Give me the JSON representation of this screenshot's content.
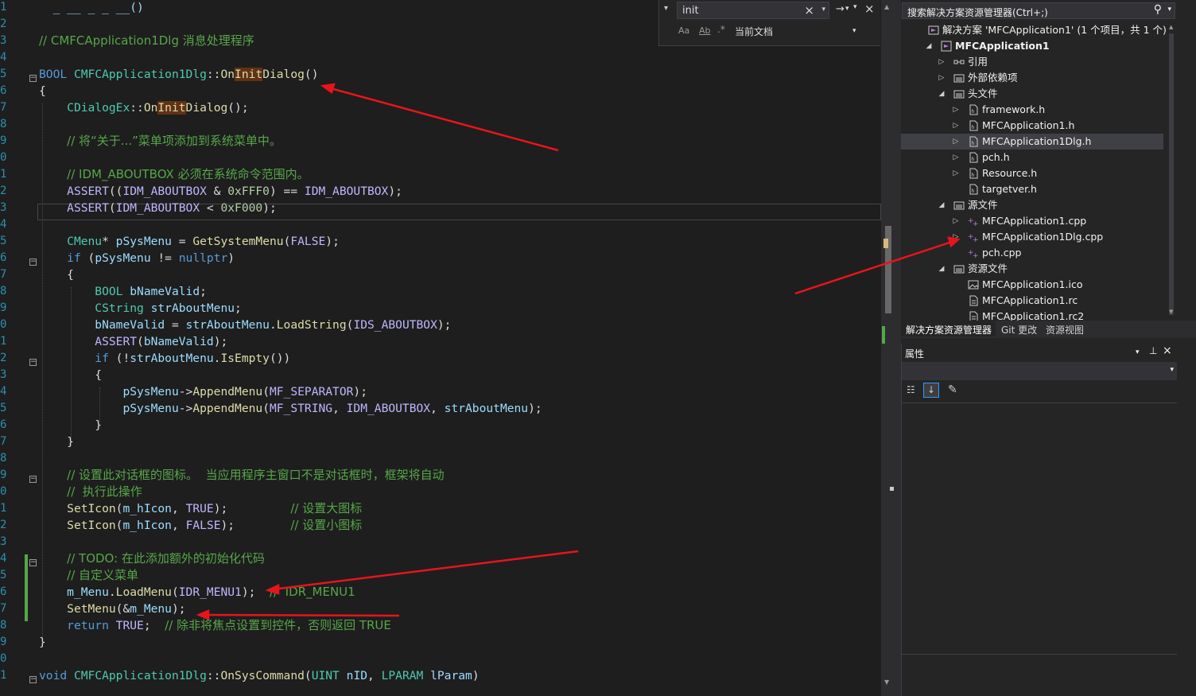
{
  "editor": {
    "lines": [
      {
        "num": "1",
        "html": "<span class='v'>  _ __ _ _ __()</span>"
      },
      {
        "num": "2",
        "html": ""
      },
      {
        "num": "3",
        "html": "<span class='c'>// CMFCApplication1Dlg 消息处理程序</span>"
      },
      {
        "num": "4",
        "html": ""
      },
      {
        "num": "5",
        "html": "<span class='k'>BOOL</span> <span class='t'>CMFCApplication1Dlg</span>::<span class='f'>On<span class='hl'>Init</span>Dialog</span>()"
      },
      {
        "num": "6",
        "html": "{"
      },
      {
        "num": "7",
        "html": "    <span class='t'>CDialogEx</span>::<span class='f'>On<span class='hl'>Init</span>Dialog</span>();"
      },
      {
        "num": "8",
        "html": ""
      },
      {
        "num": "9",
        "html": "    <span class='c'>// 将“关于...”菜单项添加到系统菜单中。</span>"
      },
      {
        "num": "0",
        "html": ""
      },
      {
        "num": "1",
        "html": "    <span class='c'>// IDM_ABOUTBOX 必须在系统命令范围内。</span>"
      },
      {
        "num": "2",
        "html": "    <span class='mac'>ASSERT</span>((<span class='mac'>IDM_ABOUTBOX</span> &amp; <span class='n'>0xFFF0</span>) == <span class='mac'>IDM_ABOUTBOX</span>);"
      },
      {
        "num": "3",
        "html": "    <span class='mac'>ASSERT</span>(<span class='mac'>IDM_ABOUTBOX</span> &lt; <span class='n'>0xF000</span>);"
      },
      {
        "num": "4",
        "html": ""
      },
      {
        "num": "5",
        "html": "    <span class='t'>CMenu</span>* <span class='v'>pSysMenu</span> = <span class='f'>GetSystemMenu</span>(<span class='mac'>FALSE</span>);"
      },
      {
        "num": "6",
        "html": "    <span class='k'>if</span> (<span class='v'>pSysMenu</span> != <span class='k'>nullptr</span>)"
      },
      {
        "num": "7",
        "html": "    {"
      },
      {
        "num": "8",
        "html": "        <span class='t'>BOOL</span> <span class='v'>bNameValid</span>;"
      },
      {
        "num": "9",
        "html": "        <span class='t'>CString</span> <span class='v'>strAboutMenu</span>;"
      },
      {
        "num": "0",
        "html": "        <span class='v'>bNameValid</span> = <span class='v'>strAboutMenu</span>.<span class='f'>LoadString</span>(<span class='mac'>IDS_ABOUTBOX</span>);"
      },
      {
        "num": "1",
        "html": "        <span class='mac'>ASSERT</span>(<span class='v'>bNameValid</span>);"
      },
      {
        "num": "2",
        "html": "        <span class='k'>if</span> (!<span class='v'>strAboutMenu</span>.<span class='f'>IsEmpty</span>())"
      },
      {
        "num": "3",
        "html": "        {"
      },
      {
        "num": "4",
        "html": "            <span class='v'>pSysMenu</span>-&gt;<span class='f'>AppendMenu</span>(<span class='mac'>MF_SEPARATOR</span>);"
      },
      {
        "num": "5",
        "html": "            <span class='v'>pSysMenu</span>-&gt;<span class='f'>AppendMenu</span>(<span class='mac'>MF_STRING</span>, <span class='mac'>IDM_ABOUTBOX</span>, <span class='v'>strAboutMenu</span>);"
      },
      {
        "num": "6",
        "html": "        }"
      },
      {
        "num": "7",
        "html": "    }"
      },
      {
        "num": "8",
        "html": ""
      },
      {
        "num": "9",
        "html": "    <span class='c'>// 设置此对话框的图标。  当应用程序主窗口不是对话框时，框架将自动</span>"
      },
      {
        "num": "0",
        "html": "    <span class='c'>//  执行此操作</span>"
      },
      {
        "num": "1",
        "html": "    <span class='f'>SetIcon</span>(<span class='v'>m_hIcon</span>, <span class='mac'>TRUE</span>);         <span class='c'>// 设置大图标</span>"
      },
      {
        "num": "2",
        "html": "    <span class='f'>SetIcon</span>(<span class='v'>m_hIcon</span>, <span class='mac'>FALSE</span>);        <span class='c'>// 设置小图标</span>"
      },
      {
        "num": "3",
        "html": ""
      },
      {
        "num": "4",
        "html": "    <span class='c'>// TODO: 在此添加额外的初始化代码</span>"
      },
      {
        "num": "5",
        "html": "    <span class='c'>// 自定义菜单</span>"
      },
      {
        "num": "6",
        "html": "    <span class='v'>m_Menu</span>.<span class='f'>LoadMenu</span>(<span class='mac'>IDR_MENU1</span>);  <span class='c'>//  IDR_MENU1</span>"
      },
      {
        "num": "7",
        "html": "    <span class='f'>SetMenu</span>(&amp;<span class='v'>m_Menu</span>);"
      },
      {
        "num": "8",
        "html": "    <span class='k'>return</span> <span class='mac'>TRUE</span>;  <span class='c'>// 除非将焦点设置到控件，否则返回 TRUE</span>"
      },
      {
        "num": "9",
        "html": "}"
      },
      {
        "num": "0",
        "html": ""
      },
      {
        "num": "1",
        "html": "<span class='k'>void</span> <span class='t'>CMFCApplication1Dlg</span>::<span class='f'>OnSysCommand</span>(<span class='t'>UINT</span> <span class='v'>nID</span>, <span class='t'>LPARAM</span> <span class='v'>lParam</span>)"
      }
    ]
  },
  "find": {
    "query": "init",
    "close": "×",
    "scope": "当前文档",
    "match_case": "Aa",
    "whole_word": "Ab",
    "regex": ".*"
  },
  "solution_explorer": {
    "search_placeholder": "搜索解决方案资源管理器(Ctrl+;)",
    "solution_label": "解决方案 'MFCApplication1' (1 个项目，共 1 个)",
    "project": "MFCApplication1",
    "items": [
      {
        "label": "引用"
      },
      {
        "label": "外部依赖项"
      },
      {
        "label": "头文件"
      },
      {
        "label": "framework.h"
      },
      {
        "label": "MFCApplication1.h"
      },
      {
        "label": "MFCApplication1Dlg.h"
      },
      {
        "label": "pch.h"
      },
      {
        "label": "Resource.h"
      },
      {
        "label": "targetver.h"
      },
      {
        "label": "源文件"
      },
      {
        "label": "MFCApplication1.cpp"
      },
      {
        "label": "MFCApplication1Dlg.cpp"
      },
      {
        "label": "pch.cpp"
      },
      {
        "label": "资源文件"
      },
      {
        "label": "MFCApplication1.ico"
      },
      {
        "label": "MFCApplication1.rc"
      },
      {
        "label": "MFCApplication1.rc2"
      }
    ],
    "tabs": [
      "解决方案资源管理器",
      "Git 更改",
      "资源视图"
    ]
  },
  "properties": {
    "title": "属性"
  },
  "colors": {
    "annotation_arrow": "#e8141c",
    "selected_row": "#3f3f46",
    "change_bar": "#57a64a"
  }
}
